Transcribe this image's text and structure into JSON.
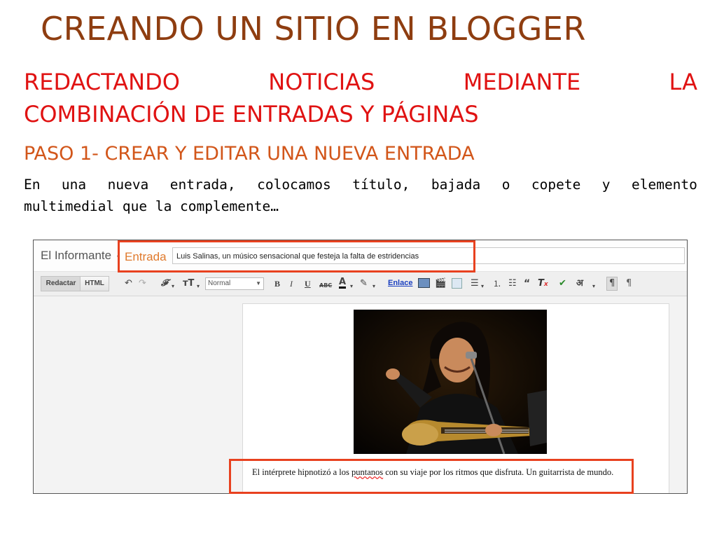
{
  "slide": {
    "title": "CREANDO UN SITIO EN BLOGGER",
    "subtitle_words_line1": [
      "REDACTANDO",
      "NOTICIAS",
      "MEDIANTE",
      "LA"
    ],
    "subtitle_line2": "COMBINACIÓN DE ENTRADAS Y PÁGINAS",
    "step_heading": "PASO 1- CREAR Y EDITAR UNA NUEVA ENTRADA",
    "body_words_line1": [
      "En",
      "una",
      "nueva",
      "entrada,",
      "colocamos",
      "título,",
      "bajada",
      "o",
      "copete",
      "y",
      "elemento"
    ],
    "body_line2": "multimedial que la complemente…"
  },
  "screenshot": {
    "blog_name": "El Informante",
    "separator": "·",
    "section_label": "Entrada",
    "post_title_value": "Luis Salinas, un músico sensacional que festeja la falta de estridencias",
    "toolbar": {
      "redactar_label": "Redactar",
      "html_label": "HTML",
      "style_select_value": "Normal",
      "link_label": "Enlace"
    },
    "caption_before": "El intérprete hipnotizó a los ",
    "caption_misspelled": "puntanos",
    "caption_after": " con su viaje por los ritmos que disfruta. Un guitarrista de mundo.",
    "highlight_color": "#e8411f"
  }
}
